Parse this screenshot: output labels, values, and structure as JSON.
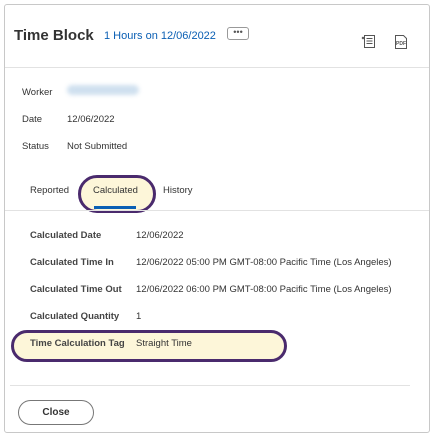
{
  "header": {
    "title": "Time Block",
    "subtitle": "1 Hours on 12/06/2022",
    "more_label": "•••",
    "pdf_label": "PDF"
  },
  "details": {
    "worker_label": "Worker",
    "date_label": "Date",
    "date_value": "12/06/2022",
    "status_label": "Status",
    "status_value": "Not Submitted"
  },
  "tabs": [
    {
      "label": "Reported",
      "selected": false
    },
    {
      "label": "Calculated",
      "selected": true
    },
    {
      "label": "History",
      "selected": false
    }
  ],
  "calculated": [
    {
      "label": "Calculated Date",
      "value": "12/06/2022"
    },
    {
      "label": "Calculated Time In",
      "value": "12/06/2022 05:00 PM GMT-08:00 Pacific Time (Los Angeles)"
    },
    {
      "label": "Calculated Time Out",
      "value": "12/06/2022 06:00 PM GMT-08:00 Pacific Time (Los Angeles)"
    },
    {
      "label": "Calculated Quantity",
      "value": "1"
    },
    {
      "label": "Time Calculation Tag",
      "value": "Straight Time"
    }
  ],
  "footer": {
    "close_label": "Close"
  },
  "colors": {
    "accent": "#0a5fb4",
    "highlight_border": "#4a2a6d",
    "highlight_fill": "#fdf6d9"
  }
}
